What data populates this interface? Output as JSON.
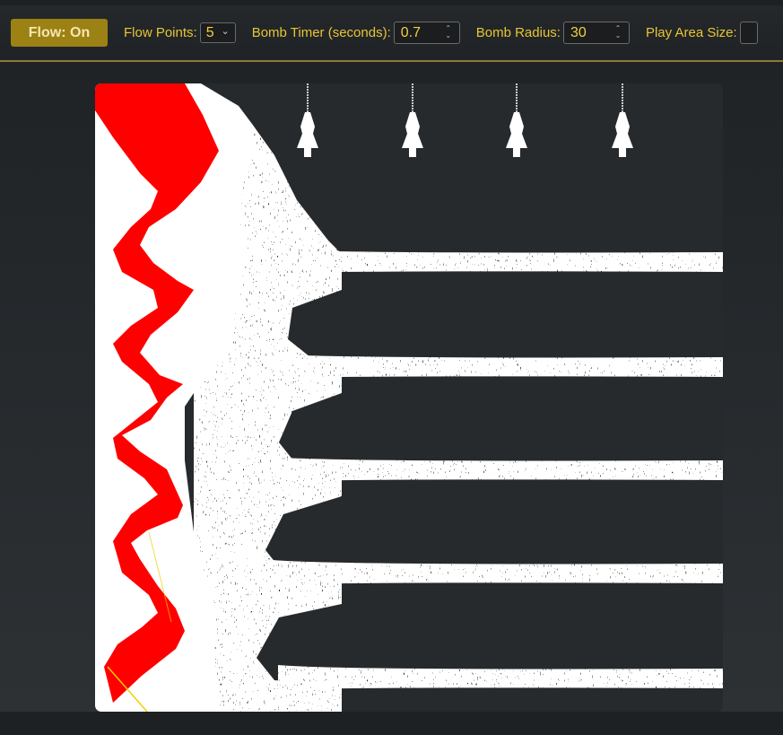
{
  "toolbar": {
    "flow_button": "Flow: On",
    "flow_points_label": "Flow Points:",
    "flow_points_value": "5",
    "bomb_timer_label": "Bomb Timer (seconds):",
    "bomb_timer_value": "0.7",
    "bomb_radius_label": "Bomb Radius:",
    "bomb_radius_value": "30",
    "play_area_label": "Play Area Size:"
  },
  "game": {
    "flow_point_count": 5,
    "colors": {
      "sand": "#ffffff",
      "fire": "#ff0000",
      "fuse": "#f0d000",
      "background": "#262a2c"
    },
    "icons": [
      "sand-spout-icon",
      "sand-spout-icon",
      "sand-spout-icon",
      "sand-spout-icon"
    ]
  }
}
